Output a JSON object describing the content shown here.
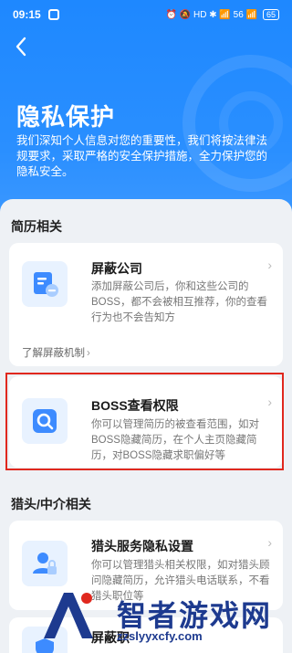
{
  "status_bar": {
    "time": "09:15",
    "icons": "⏰ 🔕 HD ✱ 📶 56 📶",
    "battery": "65"
  },
  "header": {
    "back_icon": "chevron-left-icon",
    "title": "隐私保护",
    "description": "我们深知个人信息对您的重要性，我们将按法律法规要求，采取严格的安全保护措施，全力保护您的隐私安全。"
  },
  "sections": [
    {
      "title": "简历相关",
      "cards": [
        {
          "icon": "shield-document-icon",
          "title": "屏蔽公司",
          "body": "添加屏蔽公司后，你和这些公司的BOSS，都不会被相互推荐，你的查看行为也不会告知方",
          "link": "了解屏蔽机制",
          "link_chevron": "›"
        },
        {
          "icon": "magnifier-icon",
          "title": "BOSS查看权限",
          "body": "你可以管理简历的被查看范围，如对BOSS隐藏简历，在个人主页隐藏简历，对BOSS隐藏求职偏好等"
        }
      ]
    },
    {
      "title": "猎头/中介相关",
      "cards": [
        {
          "icon": "person-lock-icon",
          "title": "猎头服务隐私设置",
          "body": "你可以管理猎头相关权限，如对猎头顾问隐藏简历，允许猎头电话联系，不看猎头职位等"
        },
        {
          "icon": "shield-icon",
          "title": "屏蔽职"
        }
      ]
    }
  ],
  "watermark": {
    "name": "智者游戏网",
    "url": "zzslyyxcfy.com"
  },
  "colors": {
    "brand_blue": "#1e88ff",
    "highlight_red": "#e0281e"
  }
}
